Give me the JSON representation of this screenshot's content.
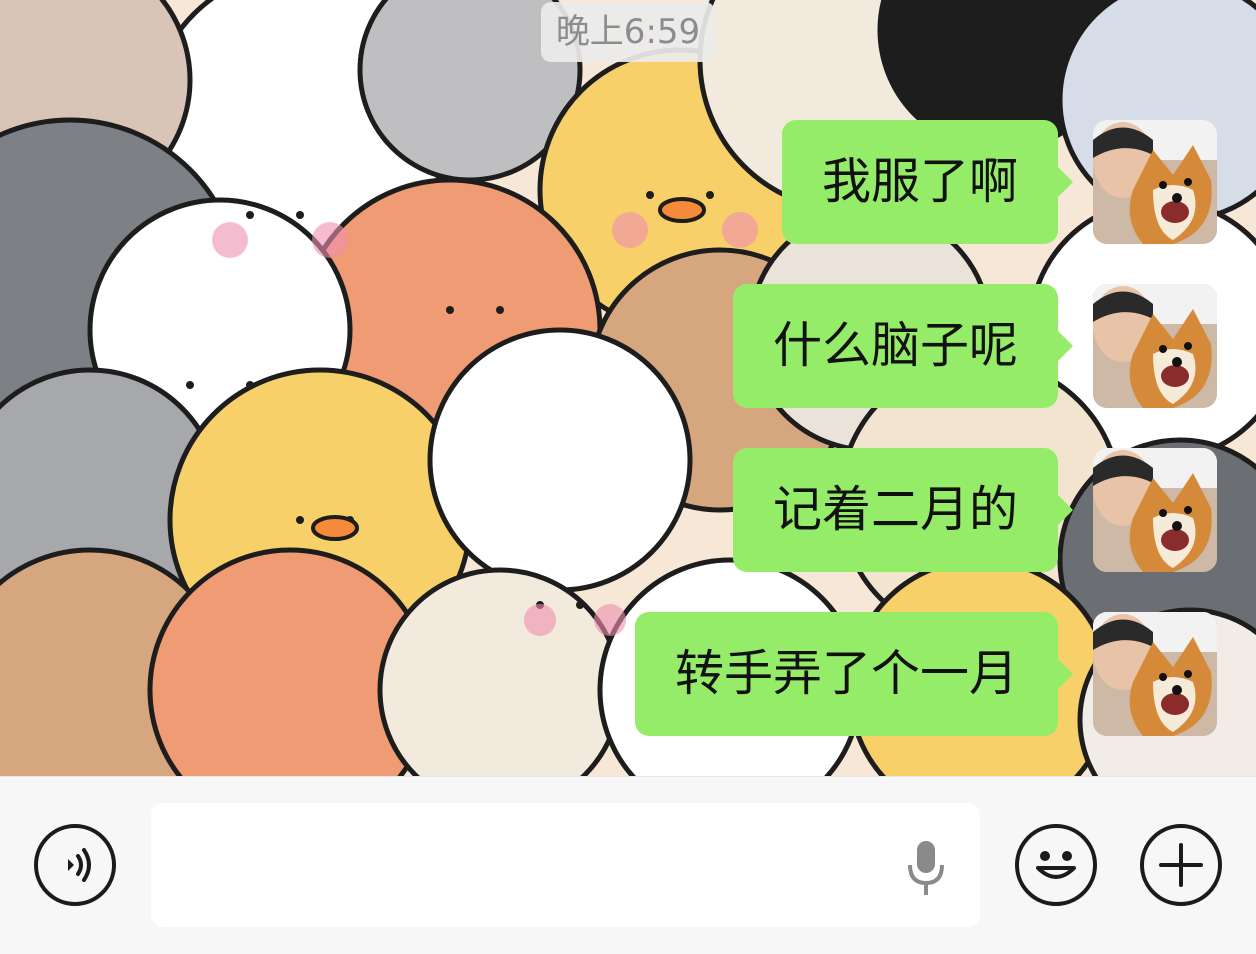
{
  "chat": {
    "timestamp": "晚上6:59",
    "messages": [
      {
        "text": "我服了啊",
        "sender": "self",
        "avatar": "avatar-photo"
      },
      {
        "text": "什么脑子呢",
        "sender": "self",
        "avatar": "avatar-photo"
      },
      {
        "text": "记着二月的",
        "sender": "self",
        "avatar": "avatar-photo"
      },
      {
        "text": "转手弄了个一月",
        "sender": "self",
        "avatar": "avatar-photo"
      }
    ]
  },
  "input_bar": {
    "voice_button_icon": "voice-wave-icon",
    "text_input_value": "",
    "text_input_icon": "microphone-icon",
    "emoji_button_icon": "smiley-icon",
    "more_button_icon": "plus-icon"
  },
  "colors": {
    "bubble_self": "#95ec69",
    "input_bar_bg": "#f7f7f7",
    "timestamp_text": "#8c8c8c"
  }
}
